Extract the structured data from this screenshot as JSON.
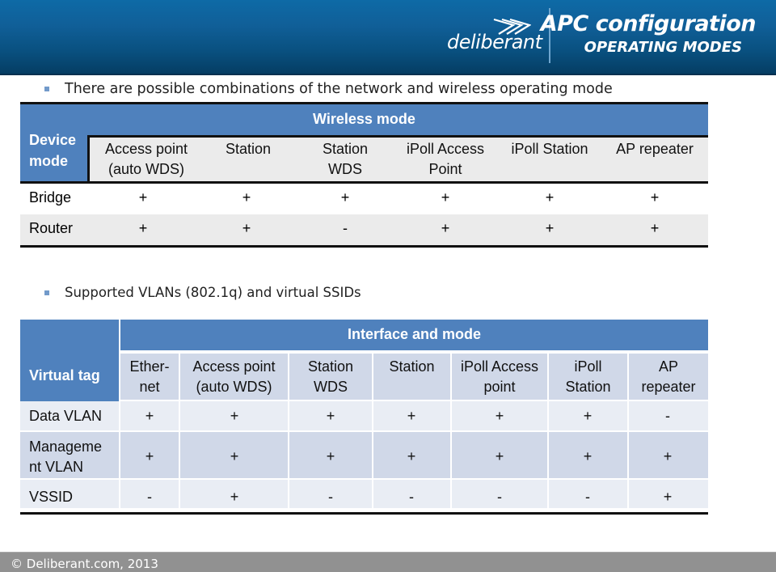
{
  "header": {
    "logo_text": "deliberant",
    "title": "APC configuration",
    "subtitle": "OPERATING MODES",
    "colors": {
      "banner_top": "#0e6aa6",
      "banner_bottom": "#053d63"
    }
  },
  "bullets": [
    "There are possible combinations of the network and wireless operating mode",
    "Supported VLANs (802.1q) and virtual SSIDs"
  ],
  "table1": {
    "corner_label": "Device mode",
    "corner_lines": [
      "Device",
      "mode"
    ],
    "group_header": "Wireless mode",
    "columns": [
      {
        "lines": [
          "Access point",
          "(auto WDS)"
        ]
      },
      {
        "lines": [
          "Station",
          ""
        ]
      },
      {
        "lines": [
          "Station",
          "WDS"
        ]
      },
      {
        "lines": [
          "iPoll Access",
          "Point"
        ]
      },
      {
        "lines": [
          "iPoll Station",
          ""
        ]
      },
      {
        "lines": [
          "AP repeater",
          ""
        ]
      }
    ],
    "rows": [
      {
        "label": "Bridge",
        "values": [
          "+",
          "+",
          "+",
          "+",
          "+",
          "+"
        ]
      },
      {
        "label": "Router",
        "values": [
          "+",
          "+",
          "-",
          "+",
          "+",
          "+"
        ]
      }
    ],
    "colors": {
      "header": "#4f81bd",
      "subheader": "#ebebeb"
    }
  },
  "table2": {
    "corner_label": "Virtual tag",
    "group_header": "Interface and mode",
    "columns": [
      {
        "lines": [
          "Ether-",
          "net"
        ]
      },
      {
        "lines": [
          "Access point",
          "(auto WDS)"
        ]
      },
      {
        "lines": [
          "Station",
          "WDS"
        ]
      },
      {
        "lines": [
          "Station",
          ""
        ]
      },
      {
        "lines": [
          "iPoll Access",
          "point"
        ]
      },
      {
        "lines": [
          "iPoll",
          "Station"
        ]
      },
      {
        "lines": [
          "AP",
          "repeater"
        ]
      }
    ],
    "rows": [
      {
        "label_lines": [
          "Data VLAN"
        ],
        "values": [
          "+",
          "+",
          "+",
          "+",
          "+",
          "+",
          "-"
        ]
      },
      {
        "label_lines": [
          "Manageme",
          "nt VLAN"
        ],
        "values": [
          "+",
          "+",
          "+",
          "+",
          "+",
          "+",
          "+"
        ]
      },
      {
        "label_lines": [
          "VSSID"
        ],
        "values": [
          "-",
          "+",
          "-",
          "-",
          "-",
          "-",
          "+"
        ]
      }
    ],
    "colors": {
      "header": "#4f81bd",
      "subheader": "#d0d8e8",
      "row_light": "#e9edf4",
      "row_dark": "#d0d8e8"
    }
  },
  "footer": {
    "copyright": "© Deliberant.com, 2013"
  }
}
